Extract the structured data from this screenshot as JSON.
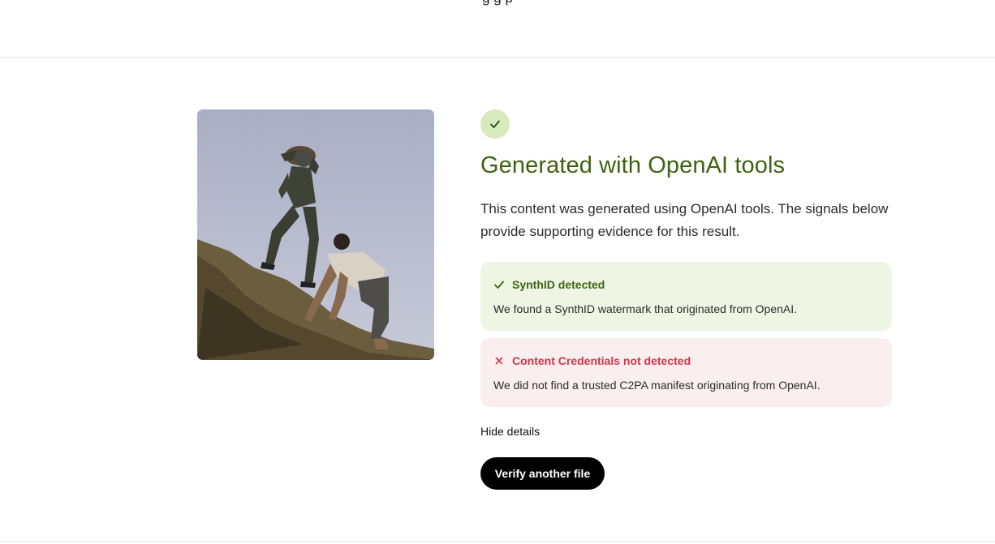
{
  "header": {
    "cut_text": "g  g  p"
  },
  "result": {
    "image_alt": "Uploaded image preview",
    "status_icon": "check-icon",
    "title": "Generated with OpenAI tools",
    "description": "This content was generated using OpenAI tools. The signals below provide supporting evidence for this result."
  },
  "signals": [
    {
      "status": "detected",
      "icon": "check-icon",
      "title": "SynthID detected",
      "body": "We found a SynthID watermark that originated from OpenAI."
    },
    {
      "status": "not_detected",
      "icon": "cross-icon",
      "title": "Content Credentials not detected",
      "body": "We did not find a trusted C2PA manifest originating from OpenAI."
    }
  ],
  "actions": {
    "toggle_details": "Hide details",
    "verify_another": "Verify another file"
  },
  "colors": {
    "success_text": "#3f6212",
    "success_bg": "#eef6e3",
    "badge_bg": "#d7eabb",
    "error_text": "#d1364b",
    "error_bg": "#fbeeee",
    "primary_button": "#000000"
  }
}
